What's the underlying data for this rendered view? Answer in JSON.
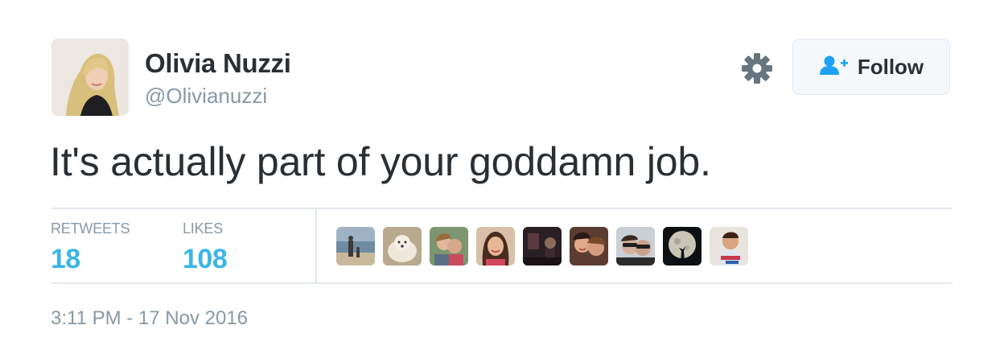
{
  "author": {
    "name": "Olivia Nuzzi",
    "handle": "@Olivianuzzi",
    "avatar_icon": "user-avatar-photo"
  },
  "actions": {
    "settings_icon": "gear-icon",
    "follow_label": "Follow",
    "follow_icon": "add-user-icon"
  },
  "tweet": {
    "text": "It's actually part of your goddamn job.",
    "timestamp": "3:11 PM - 17 Nov 2016"
  },
  "stats": {
    "retweets_label": "RETWEETS",
    "retweets_count": "18",
    "likes_label": "LIKES",
    "likes_count": "108"
  },
  "likers": [
    "liker-avatar-beach",
    "liker-avatar-dog",
    "liker-avatar-couple",
    "liker-avatar-woman",
    "liker-avatar-dark-room",
    "liker-avatar-friends",
    "liker-avatar-sunglasses",
    "liker-avatar-moon",
    "liker-avatar-child"
  ],
  "colors": {
    "accent": "#3bb5e8",
    "muted": "#8899a6",
    "text": "#292f33",
    "border": "#e1e8ed",
    "follow_icon": "#1da1f2"
  }
}
